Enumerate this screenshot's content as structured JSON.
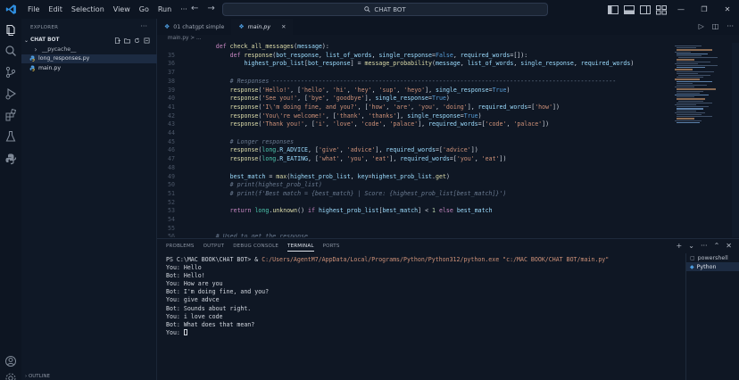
{
  "titlebar": {
    "menu": [
      "File",
      "Edit",
      "Selection",
      "View",
      "Go",
      "Run",
      "···"
    ],
    "search": "CHAT BOT"
  },
  "sidebar": {
    "title": "EXPLORER",
    "folder": "CHAT BOT",
    "tree": [
      {
        "name": "__pycache__",
        "kind": "folder",
        "selected": false
      },
      {
        "name": "long_responses.py",
        "kind": "py",
        "selected": true
      },
      {
        "name": "main.py",
        "kind": "py",
        "selected": false
      }
    ],
    "outline": "OUTLINE"
  },
  "tabs": [
    {
      "label": "01 chatgpt simple",
      "active": false
    },
    {
      "label": "main.py",
      "active": true
    }
  ],
  "breadcrumb": "main.py > ...",
  "code": [
    {
      "n": "",
      "tokens": [
        [
          "pl",
          "        "
        ],
        [
          "def",
          "def "
        ],
        [
          "fn",
          "check_all_messages"
        ],
        [
          "pl",
          "("
        ],
        [
          "var",
          "message"
        ],
        [
          "pl",
          "):"
        ]
      ]
    },
    {
      "n": "35",
      "tokens": [
        [
          "pl",
          "            "
        ],
        [
          "def",
          "def "
        ],
        [
          "fn",
          "response"
        ],
        [
          "pl",
          "("
        ],
        [
          "var",
          "bot_response"
        ],
        [
          "pl",
          ", "
        ],
        [
          "var",
          "list_of_words"
        ],
        [
          "pl",
          ", "
        ],
        [
          "var",
          "single_response"
        ],
        [
          "pl",
          "="
        ],
        [
          "bool",
          "False"
        ],
        [
          "pl",
          ", "
        ],
        [
          "var",
          "required_words"
        ],
        [
          "pl",
          "=[]):"
        ]
      ]
    },
    {
      "n": "36",
      "tokens": [
        [
          "pl",
          "                "
        ],
        [
          "var",
          "highest_prob_list"
        ],
        [
          "pl",
          "["
        ],
        [
          "var",
          "bot_response"
        ],
        [
          "pl",
          "] = "
        ],
        [
          "fn",
          "message_probability"
        ],
        [
          "pl",
          "("
        ],
        [
          "var",
          "message"
        ],
        [
          "pl",
          ", "
        ],
        [
          "var",
          "list_of_words"
        ],
        [
          "pl",
          ", "
        ],
        [
          "var",
          "single_response"
        ],
        [
          "pl",
          ", "
        ],
        [
          "var",
          "required_words"
        ],
        [
          "pl",
          ")"
        ]
      ]
    },
    {
      "n": "37",
      "tokens": []
    },
    {
      "n": "38",
      "tokens": [
        [
          "pl",
          "            "
        ],
        [
          "com",
          "# Responses -------------------------------------------------------------------------------------------------"
        ]
      ]
    },
    {
      "n": "39",
      "tokens": [
        [
          "pl",
          "            "
        ],
        [
          "fn",
          "response"
        ],
        [
          "pl",
          "("
        ],
        [
          "str",
          "'Hello!'"
        ],
        [
          "pl",
          ", ["
        ],
        [
          "str",
          "'hello'"
        ],
        [
          "pl",
          ", "
        ],
        [
          "str",
          "'hi'"
        ],
        [
          "pl",
          ", "
        ],
        [
          "str",
          "'hey'"
        ],
        [
          "pl",
          ", "
        ],
        [
          "str",
          "'sup'"
        ],
        [
          "pl",
          ", "
        ],
        [
          "str",
          "'heyo'"
        ],
        [
          "pl",
          "], "
        ],
        [
          "var",
          "single_response"
        ],
        [
          "pl",
          "="
        ],
        [
          "bool",
          "True"
        ],
        [
          "pl",
          ")"
        ]
      ]
    },
    {
      "n": "40",
      "tokens": [
        [
          "pl",
          "            "
        ],
        [
          "fn",
          "response"
        ],
        [
          "pl",
          "("
        ],
        [
          "str",
          "'See you!'"
        ],
        [
          "pl",
          ", ["
        ],
        [
          "str",
          "'bye'"
        ],
        [
          "pl",
          ", "
        ],
        [
          "str",
          "'goodbye'"
        ],
        [
          "pl",
          "], "
        ],
        [
          "var",
          "single_response"
        ],
        [
          "pl",
          "="
        ],
        [
          "bool",
          "True"
        ],
        [
          "pl",
          ")"
        ]
      ]
    },
    {
      "n": "41",
      "tokens": [
        [
          "pl",
          "            "
        ],
        [
          "fn",
          "response"
        ],
        [
          "pl",
          "("
        ],
        [
          "str",
          "'I\\'m doing fine, and you?'"
        ],
        [
          "pl",
          ", ["
        ],
        [
          "str",
          "'how'"
        ],
        [
          "pl",
          ", "
        ],
        [
          "str",
          "'are'"
        ],
        [
          "pl",
          ", "
        ],
        [
          "str",
          "'you'"
        ],
        [
          "pl",
          ", "
        ],
        [
          "str",
          "'doing'"
        ],
        [
          "pl",
          "], "
        ],
        [
          "var",
          "required_words"
        ],
        [
          "pl",
          "=["
        ],
        [
          "str",
          "'how'"
        ],
        [
          "pl",
          "])"
        ]
      ]
    },
    {
      "n": "42",
      "tokens": [
        [
          "pl",
          "            "
        ],
        [
          "fn",
          "response"
        ],
        [
          "pl",
          "("
        ],
        [
          "str",
          "'You\\'re welcome!'"
        ],
        [
          "pl",
          ", ["
        ],
        [
          "str",
          "'thank'"
        ],
        [
          "pl",
          ", "
        ],
        [
          "str",
          "'thanks'"
        ],
        [
          "pl",
          "], "
        ],
        [
          "var",
          "single_response"
        ],
        [
          "pl",
          "="
        ],
        [
          "bool",
          "True"
        ],
        [
          "pl",
          ")"
        ]
      ]
    },
    {
      "n": "43",
      "tokens": [
        [
          "pl",
          "            "
        ],
        [
          "fn",
          "response"
        ],
        [
          "pl",
          "("
        ],
        [
          "str",
          "'Thank you!'"
        ],
        [
          "pl",
          ", ["
        ],
        [
          "str",
          "'i'"
        ],
        [
          "pl",
          ", "
        ],
        [
          "str",
          "'love'"
        ],
        [
          "pl",
          ", "
        ],
        [
          "str",
          "'code'"
        ],
        [
          "pl",
          ", "
        ],
        [
          "str",
          "'palace'"
        ],
        [
          "pl",
          "], "
        ],
        [
          "var",
          "required_words"
        ],
        [
          "pl",
          "=["
        ],
        [
          "str",
          "'code'"
        ],
        [
          "pl",
          ", "
        ],
        [
          "str",
          "'palace'"
        ],
        [
          "pl",
          "])"
        ]
      ]
    },
    {
      "n": "44",
      "tokens": []
    },
    {
      "n": "45",
      "tokens": [
        [
          "pl",
          "            "
        ],
        [
          "com",
          "# Longer responses"
        ]
      ]
    },
    {
      "n": "46",
      "tokens": [
        [
          "pl",
          "            "
        ],
        [
          "fn",
          "response"
        ],
        [
          "pl",
          "("
        ],
        [
          "cls",
          "long"
        ],
        [
          "pl",
          "."
        ],
        [
          "var",
          "R_ADVICE"
        ],
        [
          "pl",
          ", ["
        ],
        [
          "str",
          "'give'"
        ],
        [
          "pl",
          ", "
        ],
        [
          "str",
          "'advice'"
        ],
        [
          "pl",
          "], "
        ],
        [
          "var",
          "required_words"
        ],
        [
          "pl",
          "=["
        ],
        [
          "str",
          "'advice'"
        ],
        [
          "pl",
          "])"
        ]
      ]
    },
    {
      "n": "47",
      "tokens": [
        [
          "pl",
          "            "
        ],
        [
          "fn",
          "response"
        ],
        [
          "pl",
          "("
        ],
        [
          "cls",
          "long"
        ],
        [
          "pl",
          "."
        ],
        [
          "var",
          "R_EATING"
        ],
        [
          "pl",
          ", ["
        ],
        [
          "str",
          "'what'"
        ],
        [
          "pl",
          ", "
        ],
        [
          "str",
          "'you'"
        ],
        [
          "pl",
          ", "
        ],
        [
          "str",
          "'eat'"
        ],
        [
          "pl",
          "], "
        ],
        [
          "var",
          "required_words"
        ],
        [
          "pl",
          "=["
        ],
        [
          "str",
          "'you'"
        ],
        [
          "pl",
          ", "
        ],
        [
          "str",
          "'eat'"
        ],
        [
          "pl",
          "])"
        ]
      ]
    },
    {
      "n": "48",
      "tokens": []
    },
    {
      "n": "49",
      "tokens": [
        [
          "pl",
          "            "
        ],
        [
          "var",
          "best_match"
        ],
        [
          "pl",
          " = "
        ],
        [
          "fn",
          "max"
        ],
        [
          "pl",
          "("
        ],
        [
          "var",
          "highest_prob_list"
        ],
        [
          "pl",
          ", "
        ],
        [
          "var",
          "key"
        ],
        [
          "pl",
          "="
        ],
        [
          "var",
          "highest_prob_list"
        ],
        [
          "pl",
          "."
        ],
        [
          "fn",
          "get"
        ],
        [
          "pl",
          ")"
        ]
      ]
    },
    {
      "n": "50",
      "tokens": [
        [
          "pl",
          "            "
        ],
        [
          "com",
          "# print(highest_prob_list)"
        ]
      ]
    },
    {
      "n": "51",
      "tokens": [
        [
          "pl",
          "            "
        ],
        [
          "com",
          "# print(f'Best match = {best_match} | Score: {highest_prob_list[best_match]}')"
        ]
      ]
    },
    {
      "n": "52",
      "tokens": []
    },
    {
      "n": "53",
      "tokens": [
        [
          "pl",
          "            "
        ],
        [
          "def",
          "return "
        ],
        [
          "cls",
          "long"
        ],
        [
          "pl",
          "."
        ],
        [
          "fn",
          "unknown"
        ],
        [
          "pl",
          "() "
        ],
        [
          "def",
          "if "
        ],
        [
          "var",
          "highest_prob_list"
        ],
        [
          "pl",
          "["
        ],
        [
          "var",
          "best_match"
        ],
        [
          "pl",
          "] < "
        ],
        [
          "num",
          "1"
        ],
        [
          "def",
          " else "
        ],
        [
          "var",
          "best_match"
        ]
      ]
    },
    {
      "n": "54",
      "tokens": []
    },
    {
      "n": "55",
      "tokens": []
    },
    {
      "n": "56",
      "tokens": [
        [
          "pl",
          "        "
        ],
        [
          "com",
          "# Used to get the response"
        ]
      ]
    }
  ],
  "panel": {
    "tabs": [
      "PROBLEMS",
      "OUTPUT",
      "DEBUG CONSOLE",
      "TERMINAL",
      "PORTS"
    ],
    "active_tab": "TERMINAL",
    "terminal": [
      {
        "parts": [
          [
            "path",
            "PS C:\\MAC BOOK\\CHAT BOT> & "
          ],
          [
            "str",
            "C:/Users/AgentM7/AppData/Local/Programs/Python/Python312/python.exe"
          ],
          [
            "path",
            " "
          ],
          [
            "str",
            "\"c:/MAC BOOK/CHAT BOT/main.py\""
          ]
        ]
      },
      {
        "parts": [
          [
            "path",
            "You: Hello"
          ]
        ]
      },
      {
        "parts": [
          [
            "path",
            "Bot: Hello!"
          ]
        ]
      },
      {
        "parts": [
          [
            "path",
            "You: How are you"
          ]
        ]
      },
      {
        "parts": [
          [
            "path",
            "Bot: I'm doing fine, and you?"
          ]
        ]
      },
      {
        "parts": [
          [
            "path",
            "You: give advce"
          ]
        ]
      },
      {
        "parts": [
          [
            "path",
            "Bot: Sounds about right."
          ]
        ]
      },
      {
        "parts": [
          [
            "path",
            "You: i love code"
          ]
        ]
      },
      {
        "parts": [
          [
            "path",
            "Bot: What does that mean?"
          ]
        ]
      },
      {
        "parts": [
          [
            "path",
            "You: "
          ]
        ],
        "cursor": true
      }
    ],
    "terminals": [
      {
        "name": "powershell",
        "active": false
      },
      {
        "name": "Python",
        "active": true
      }
    ]
  }
}
